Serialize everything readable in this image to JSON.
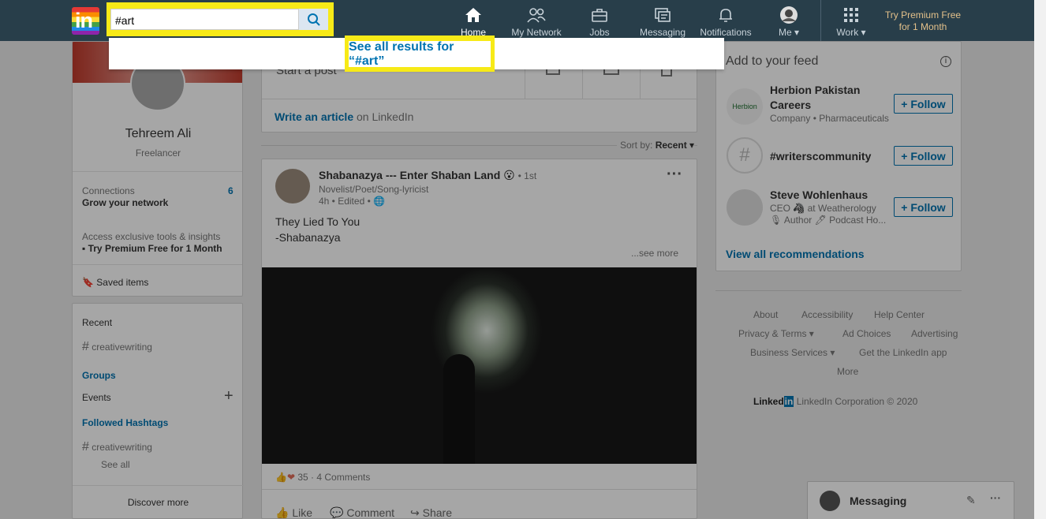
{
  "search": {
    "value": "#art",
    "see_all": "See all results for “#art”"
  },
  "nav": {
    "items": [
      {
        "label": "Home",
        "icon": "home-icon"
      },
      {
        "label": "My Network",
        "icon": "network-icon"
      },
      {
        "label": "Jobs",
        "icon": "jobs-icon"
      },
      {
        "label": "Messaging",
        "icon": "messaging-icon"
      },
      {
        "label": "Notifications",
        "icon": "bell-icon"
      },
      {
        "label": "Me",
        "icon": "avatar-icon"
      },
      {
        "label": "Work",
        "icon": "grid-icon"
      }
    ],
    "premium": "Try Premium Free for 1 Month"
  },
  "profile": {
    "name": "Tehreem Ali",
    "headline": "Freelancer",
    "connections_label": "Connections",
    "connections_count": "6",
    "grow": "Grow your network",
    "access": "Access exclusive tools & insights",
    "premium": "Try Premium Free for 1 Month",
    "saved": "Saved items"
  },
  "sidebar": {
    "recent": "Recent",
    "recent_tag": "creativewriting",
    "groups": "Groups",
    "events": "Events",
    "followed": "Followed Hashtags",
    "followed_tag": "creativewriting",
    "see_all": "See all",
    "discover": "Discover more"
  },
  "share": {
    "start": "Start a post",
    "write": "Write an article",
    "on": "on LinkedIn"
  },
  "sort": {
    "label": "Sort by:",
    "value": "Recent"
  },
  "post": {
    "author": "Shabanazya --- Enter Shaban Land",
    "degree": "• 1st",
    "headline": "Novelist/Poet/Song-lyricist",
    "time": "4h • Edited •",
    "line1": "They Lied To You",
    "line2": "-Shabanazya",
    "see_more": "...see more",
    "reactions": "35 · 4 Comments",
    "like": "Like",
    "comment": "Comment",
    "share": "Share"
  },
  "feed": {
    "title": "Add to your feed",
    "items": [
      {
        "name": "Herbion Pakistan Careers",
        "sub": "Company • Pharmaceuticals",
        "follow": "Follow"
      },
      {
        "name": "#writerscommunity",
        "sub": "",
        "follow": "Follow"
      },
      {
        "name": "Steve Wohlenhaus",
        "sub": "CEO 🦓 at Weatherology",
        "sub2": "🎙 Author 🖊 Podcast Ho...",
        "follow": "Follow"
      }
    ],
    "view_all": "View all recommendations"
  },
  "footer": {
    "links": [
      "About",
      "Accessibility",
      "Help Center",
      "Privacy & Terms",
      "Ad Choices",
      "Advertising",
      "Business Services",
      "Get the LinkedIn app",
      "More"
    ],
    "brand": "LinkedIn Corporation © 2020"
  },
  "messaging": {
    "label": "Messaging"
  },
  "colors": {
    "nav": "#283e4a",
    "highlight": "#f7ea17",
    "link": "#0073b1"
  }
}
